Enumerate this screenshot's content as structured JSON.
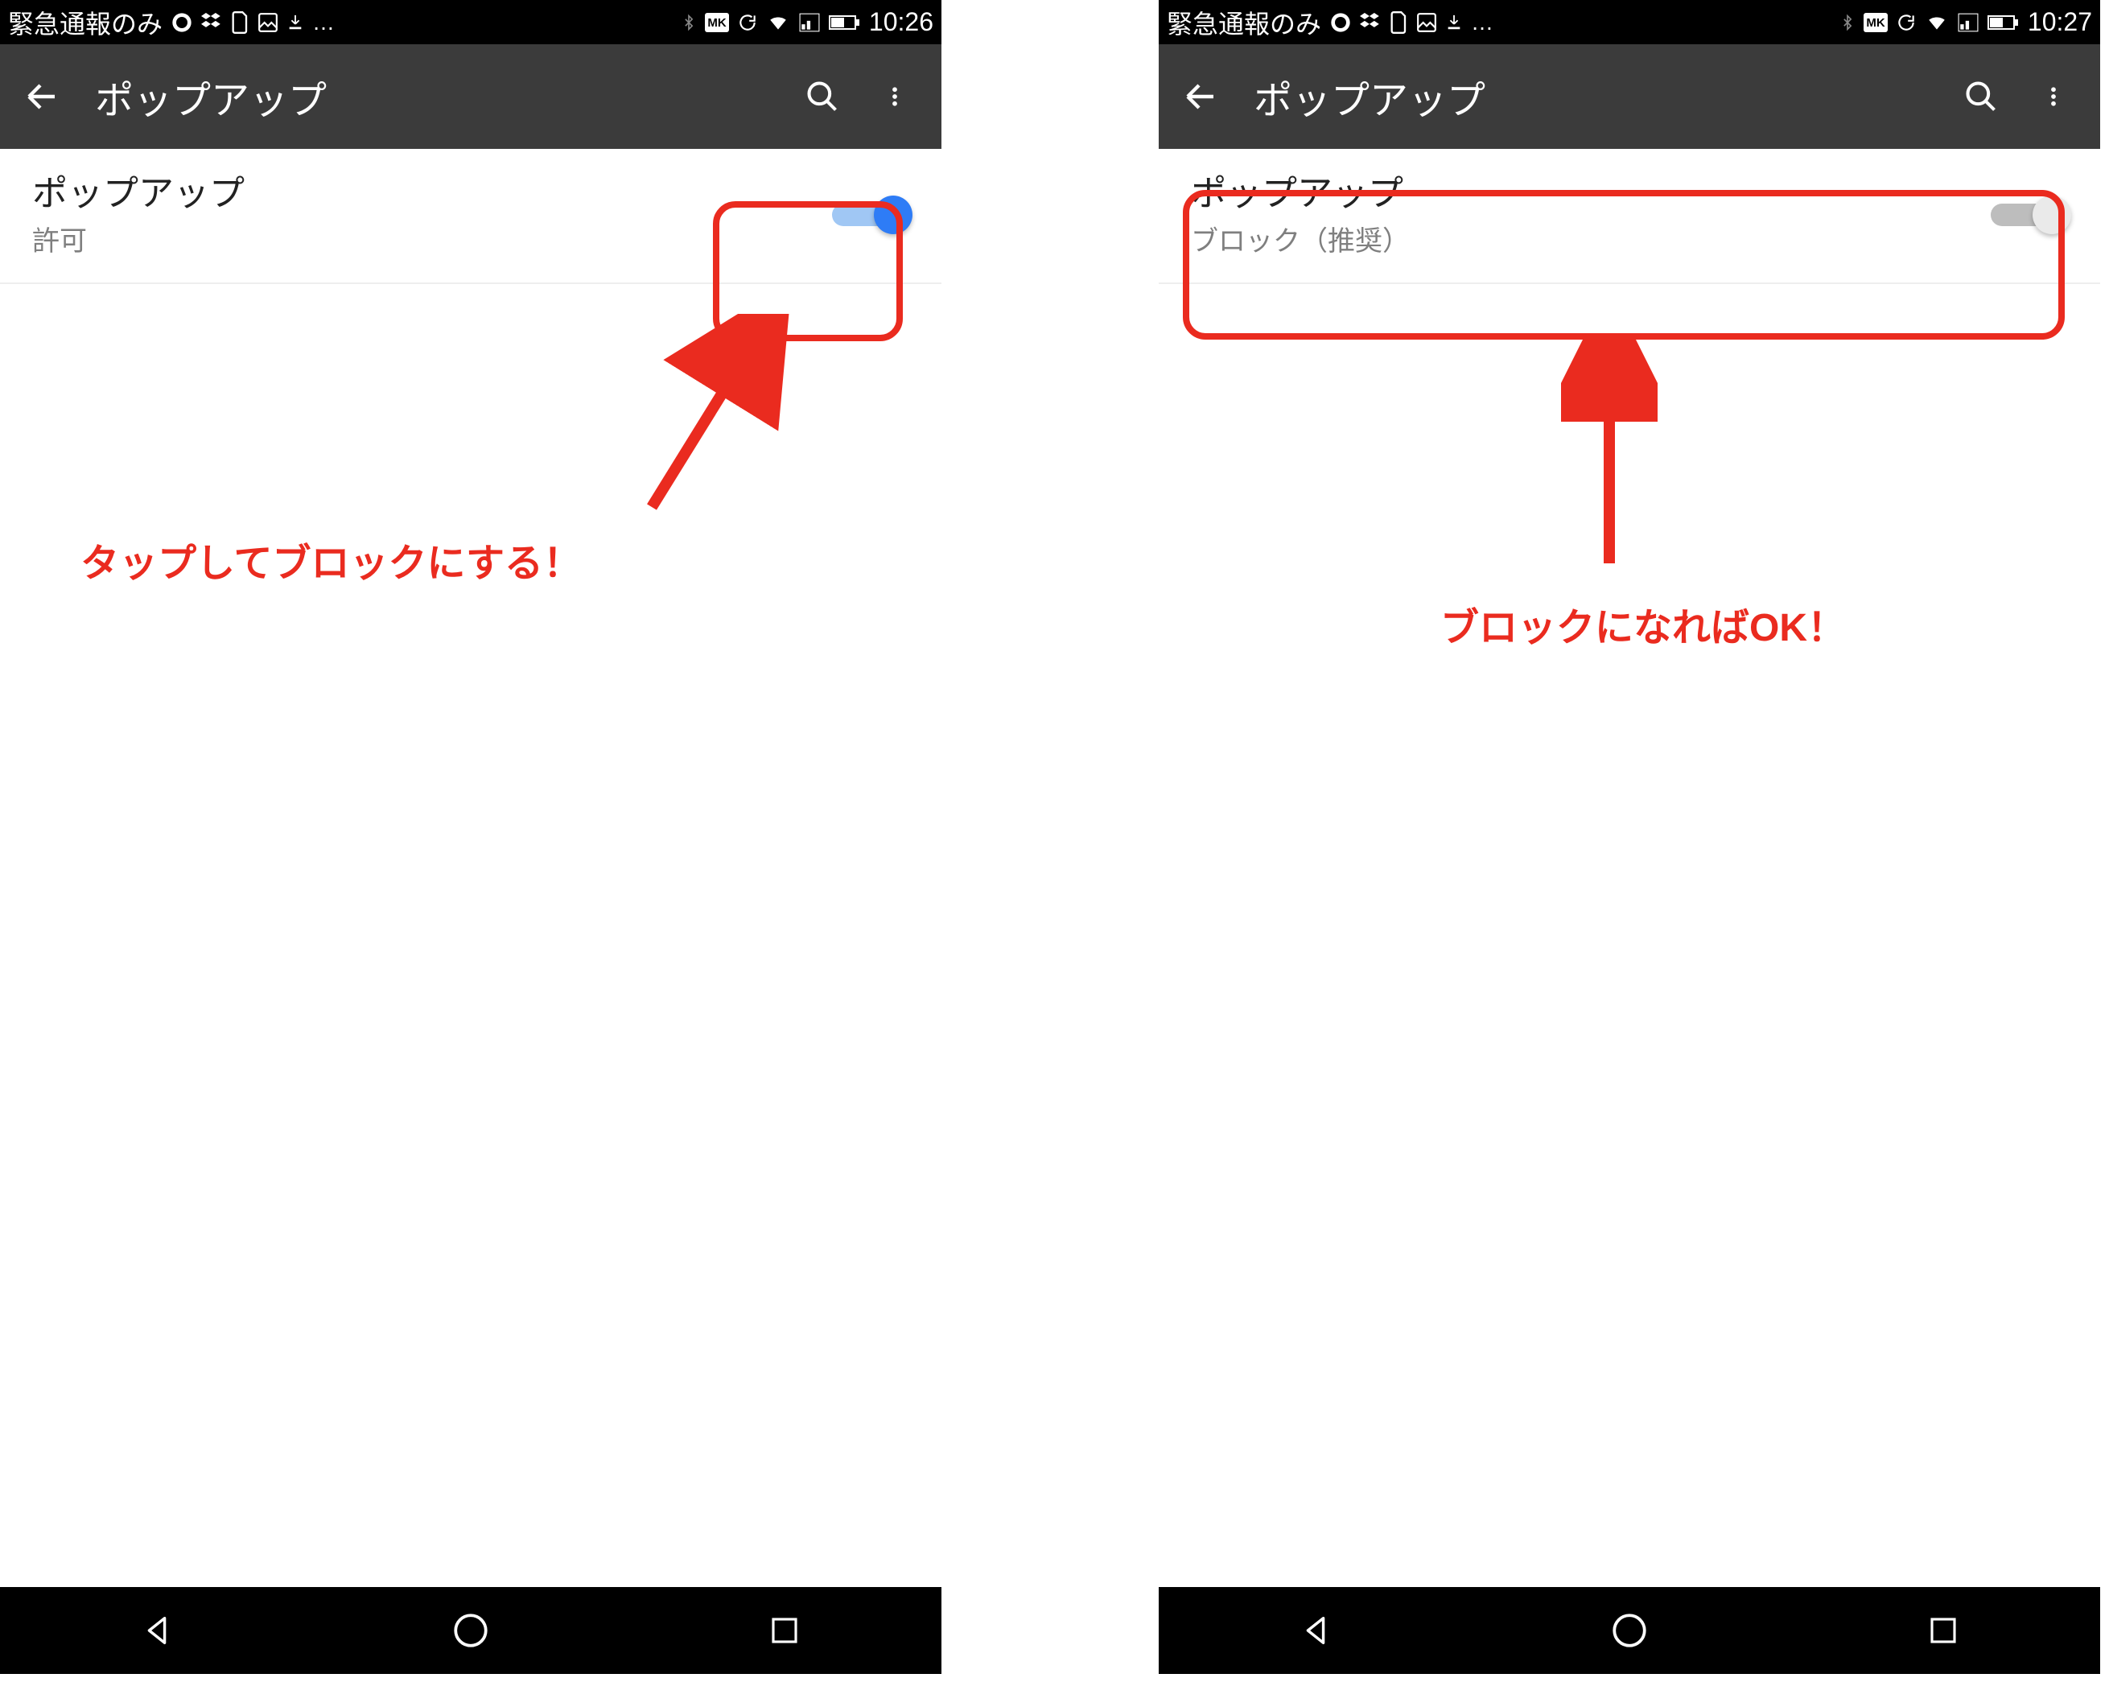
{
  "left": {
    "status": {
      "carrier": "緊急通報のみ",
      "time": "10:26"
    },
    "appbar": {
      "title": "ポップアップ"
    },
    "row": {
      "label": "ポップアップ",
      "sublabel": "許可"
    },
    "annotation": "タップしてブロックにする！"
  },
  "right": {
    "status": {
      "carrier": "緊急通報のみ",
      "time": "10:27"
    },
    "appbar": {
      "title": "ポップアップ"
    },
    "row": {
      "label": "ポップアップ",
      "sublabel": "ブロック（推奨）"
    },
    "annotation": "ブロックになればOK！"
  }
}
